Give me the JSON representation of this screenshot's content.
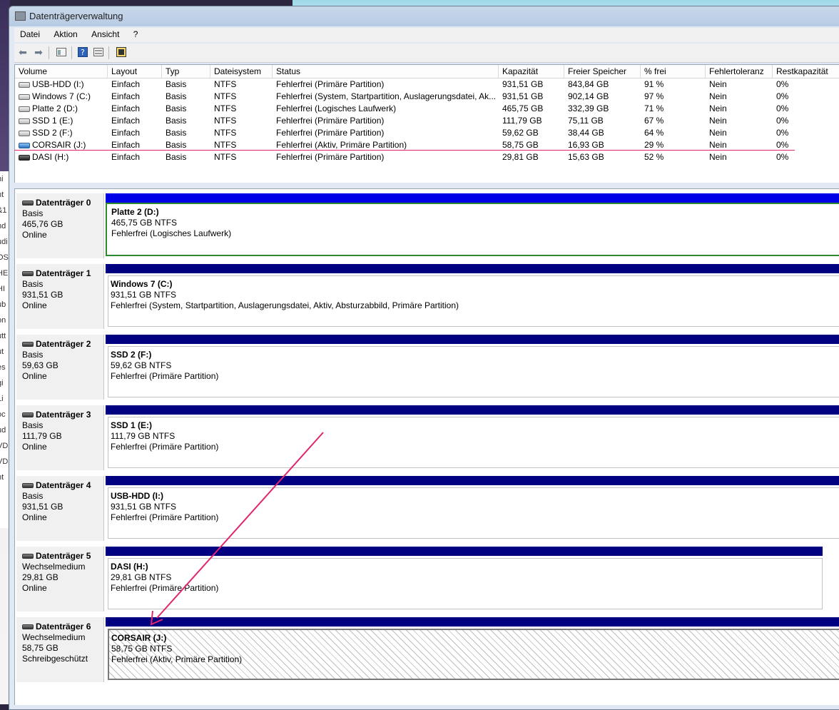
{
  "window": {
    "title": "Datenträgerverwaltung"
  },
  "menu": [
    "Datei",
    "Aktion",
    "Ansicht",
    "?"
  ],
  "background_sidebar_text": [
    "hi",
    "nt",
    "&1",
    "nd",
    "udi",
    "OS",
    "HE",
    "HI",
    "ub",
    "on",
    "utt",
    "ut",
    "es",
    "gi",
    "Li",
    "oc",
    "ud",
    "VD",
    "VD",
    "nt"
  ],
  "volume_columns": [
    "Volume",
    "Layout",
    "Typ",
    "Dateisystem",
    "Status",
    "Kapazität",
    "Freier Speicher",
    "% frei",
    "Fehlertoleranz",
    "Restkapazität"
  ],
  "volumes": [
    {
      "icon": "drive-icon",
      "volume": "USB-HDD (I:)",
      "layout": "Einfach",
      "typ": "Basis",
      "fs": "NTFS",
      "status": "Fehlerfrei (Primäre Partition)",
      "kap": "931,51 GB",
      "frei": "843,84 GB",
      "pct": "91 %",
      "ft": "Nein",
      "rest": "0%"
    },
    {
      "icon": "drive-icon",
      "volume": "Windows 7 (C:)",
      "layout": "Einfach",
      "typ": "Basis",
      "fs": "NTFS",
      "status": "Fehlerfrei (System, Startpartition, Auslagerungsdatei, Ak...",
      "kap": "931,51 GB",
      "frei": "902,14 GB",
      "pct": "97 %",
      "ft": "Nein",
      "rest": "0%"
    },
    {
      "icon": "drive-icon",
      "volume": "Platte 2 (D:)",
      "layout": "Einfach",
      "typ": "Basis",
      "fs": "NTFS",
      "status": "Fehlerfrei (Logisches Laufwerk)",
      "kap": "465,75 GB",
      "frei": "332,39 GB",
      "pct": "71 %",
      "ft": "Nein",
      "rest": "0%"
    },
    {
      "icon": "drive-icon",
      "volume": "SSD 1 (E:)",
      "layout": "Einfach",
      "typ": "Basis",
      "fs": "NTFS",
      "status": "Fehlerfrei (Primäre Partition)",
      "kap": "111,79 GB",
      "frei": "75,11 GB",
      "pct": "67 %",
      "ft": "Nein",
      "rest": "0%"
    },
    {
      "icon": "drive-icon",
      "volume": "SSD 2 (F:)",
      "layout": "Einfach",
      "typ": "Basis",
      "fs": "NTFS",
      "status": "Fehlerfrei (Primäre Partition)",
      "kap": "59,62 GB",
      "frei": "38,44 GB",
      "pct": "64 %",
      "ft": "Nein",
      "rest": "0%"
    },
    {
      "icon": "removable-blue-icon",
      "volume": "CORSAIR (J:)",
      "layout": "Einfach",
      "typ": "Basis",
      "fs": "NTFS",
      "status": "Fehlerfrei (Aktiv, Primäre Partition)",
      "kap": "58,75 GB",
      "frei": "16,93 GB",
      "pct": "29 %",
      "ft": "Nein",
      "rest": "0%"
    },
    {
      "icon": "removable-dark-icon",
      "volume": "DASI (H:)",
      "layout": "Einfach",
      "typ": "Basis",
      "fs": "NTFS",
      "status": "Fehlerfrei (Primäre Partition)",
      "kap": "29,81 GB",
      "frei": "15,63 GB",
      "pct": "52 %",
      "ft": "Nein",
      "rest": "0%"
    }
  ],
  "disks": [
    {
      "name": "Datenträger 0",
      "type": "Basis",
      "size": "465,76 GB",
      "state": "Online",
      "part_title": "Platte 2  (D:)",
      "part_size": "465,75 GB NTFS",
      "part_status": "Fehlerfrei (Logisches Laufwerk)"
    },
    {
      "name": "Datenträger 1",
      "type": "Basis",
      "size": "931,51 GB",
      "state": "Online",
      "part_title": "Windows 7  (C:)",
      "part_size": "931,51 GB NTFS",
      "part_status": "Fehlerfrei (System, Startpartition, Auslagerungsdatei, Aktiv, Absturzabbild, Primäre Partition)"
    },
    {
      "name": "Datenträger 2",
      "type": "Basis",
      "size": "59,63 GB",
      "state": "Online",
      "part_title": "SSD 2  (F:)",
      "part_size": "59,62 GB NTFS",
      "part_status": "Fehlerfrei (Primäre Partition)"
    },
    {
      "name": "Datenträger 3",
      "type": "Basis",
      "size": "111,79 GB",
      "state": "Online",
      "part_title": "SSD 1  (E:)",
      "part_size": "111,79 GB NTFS",
      "part_status": "Fehlerfrei (Primäre Partition)"
    },
    {
      "name": "Datenträger 4",
      "type": "Basis",
      "size": "931,51 GB",
      "state": "Online",
      "part_title": "USB-HDD  (I:)",
      "part_size": "931,51 GB NTFS",
      "part_status": "Fehlerfrei (Primäre Partition)"
    },
    {
      "name": "Datenträger 5",
      "type": "Wechselmedium",
      "size": "29,81 GB",
      "state": "Online",
      "part_title": "DASI  (H:)",
      "part_size": "29,81 GB NTFS",
      "part_status": "Fehlerfrei (Primäre Partition)"
    },
    {
      "name": "Datenträger 6",
      "type": "Wechselmedium",
      "size": "58,75 GB",
      "state": "Schreibgeschützt",
      "part_title": "CORSAIR  (J:)",
      "part_size": "58,75 GB NTFS",
      "part_status": "Fehlerfrei (Aktiv, Primäre Partition)"
    }
  ],
  "colors": {
    "annotation": "#e0266e",
    "partition_bar": "#000080",
    "logical_bar": "#0000e6",
    "selected_border": "#2f8a2f"
  }
}
